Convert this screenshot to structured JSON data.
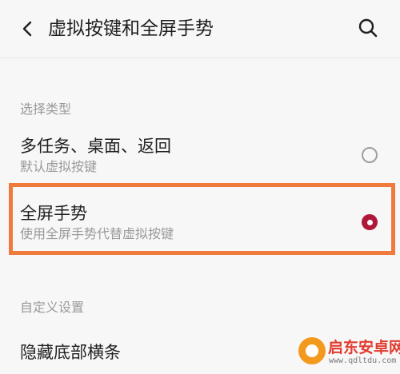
{
  "header": {
    "title": "虚拟按键和全屏手势",
    "back_icon": "back-arrow-icon",
    "search_icon": "search-icon"
  },
  "sections": {
    "select_type": "选择类型",
    "custom_settings": "自定义设置"
  },
  "options": [
    {
      "title": "多任务、桌面、返回",
      "subtitle": "默认虚拟按键",
      "selected": false
    },
    {
      "title": "全屏手势",
      "subtitle": "使用全屏手势代替虚拟按键",
      "selected": true
    }
  ],
  "custom": {
    "hide_bottom_bar": "隐藏底部横条"
  },
  "watermark": {
    "brand": "启东安卓网",
    "url": "www.qdltdu.com"
  },
  "colors": {
    "accent": "#b0183a",
    "highlight": "#f07a3c",
    "background": "#f7f7f7"
  }
}
